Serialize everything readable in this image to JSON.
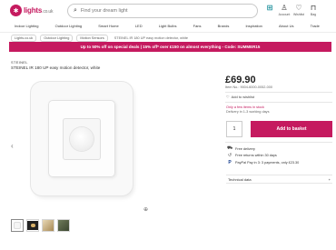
{
  "header": {
    "logo_text": "lights",
    "logo_suffix": ".co.uk",
    "search_placeholder": "Find your dream light",
    "icons": [
      {
        "icon": "basket-teal-icon",
        "label": ""
      },
      {
        "icon": "user-icon",
        "label": "Account"
      },
      {
        "icon": "heart-icon",
        "label": "Wishlist"
      },
      {
        "icon": "bag-icon",
        "label": "Bag"
      }
    ]
  },
  "nav": {
    "items": [
      "Indoor Lighting",
      "Outdoor Lighting",
      "Smart Home",
      "LED",
      "Light Bulbs",
      "Fans",
      "Brands",
      "Inspiration",
      "About Us",
      "Trade"
    ]
  },
  "breadcrumbs": [
    "Lights.co.uk",
    "Outdoor Lighting",
    "Motion Sensors",
    "STEINEL IR 180 UP easy motion detector, white"
  ],
  "banner": {
    "text": "Up to 50% off on special deals | 15% off* over £150 on almost everything - Code: SUMMER15"
  },
  "product": {
    "brand": "STEINEL",
    "title": "STEINEL IR 180 UP easy motion detector, white",
    "price": "£69.90",
    "sku": "Item No.: 9004-6000-0052-000",
    "wishlist_label": "Add to wishlist",
    "stock_line1": "Only a few items in stock",
    "stock_line2": "Delivery in 1-3 working days",
    "quantity": "1",
    "add_button": "Add to basket",
    "features": [
      {
        "icon": "truck-icon",
        "text": "Free delivery"
      },
      {
        "icon": "return-icon",
        "text": "Free returns within 30 days"
      },
      {
        "icon": "paypal-icon",
        "text": "PayPal Pay in 3: 3 payments, only £23.30"
      }
    ],
    "specs_label": "Technical data",
    "specs_toggle": "+"
  },
  "gallery": {
    "prev": "‹",
    "next": "›",
    "zoom": "⊕",
    "thumbnails": [
      "thumb-product",
      "thumb-dark",
      "thumb-warm",
      "thumb-green"
    ]
  },
  "colors": {
    "accent": "#c51a5f",
    "teal": "#118a96"
  }
}
